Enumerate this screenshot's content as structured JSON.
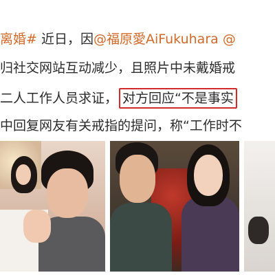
{
  "post": {
    "line1": {
      "hashtag": "离婚#",
      "text_after_hashtag": " 近日，因",
      "mention": "@福原愛AiFukuhara",
      "text_end": " @"
    },
    "line2": {
      "text": "归社交网站互动减少，且照片中未戴婚戒"
    },
    "line3": {
      "text_before": "二人工作人员求证，",
      "highlight": "对方回应“不是事实"
    },
    "line4": {
      "text": "中回复网友有关戒指的提问，称“工作时不"
    }
  },
  "photos": {
    "count": 3
  }
}
